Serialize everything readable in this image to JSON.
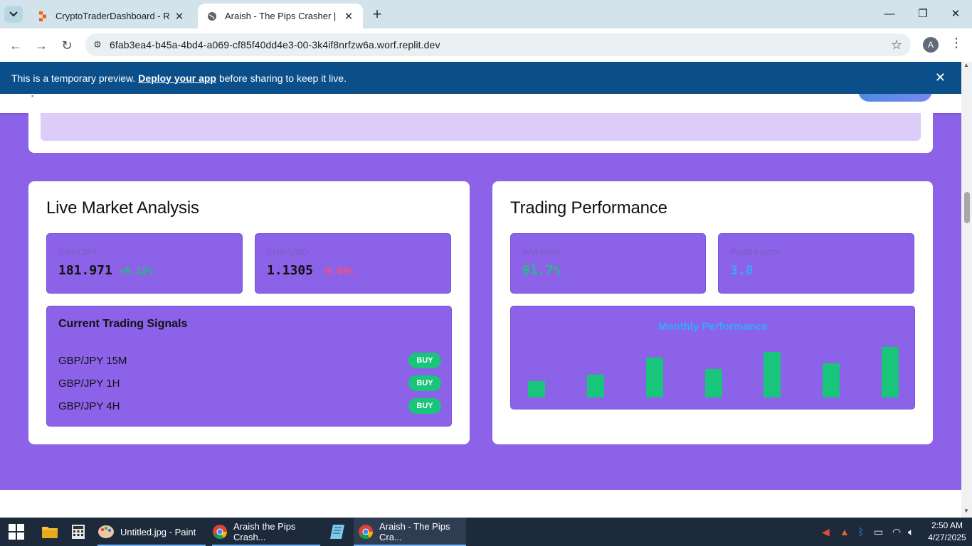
{
  "browser": {
    "tabs": [
      {
        "title": "CryptoTraderDashboard - Replit",
        "icon": "replit-icon"
      },
      {
        "title": "Araish - The Pips Crasher | Cryp",
        "icon": "globe-icon",
        "active": true
      }
    ],
    "url": "6fab3ea4-b45a-4bd4-a069-cf85f40dd4e3-00-3k4if8nrfzw6a.worf.replit.dev",
    "profile_initial": "A"
  },
  "banner": {
    "prefix": "This is a temporary preview.",
    "link": "Deploy your app",
    "suffix": "before sharing to keep it live."
  },
  "market": {
    "title": "Live Market Analysis",
    "pairs": [
      {
        "label": "GBP/JPY",
        "value": "181.971",
        "change": "+0.12%",
        "direction": "up"
      },
      {
        "label": "EUR/USD",
        "value": "1.1305",
        "change": "-0.08%",
        "direction": "down"
      }
    ],
    "signals_title": "Current Trading Signals",
    "signals": [
      {
        "pair": "GBP/JPY 15M",
        "action": "BUY"
      },
      {
        "pair": "GBP/JPY 1H",
        "action": "BUY"
      },
      {
        "pair": "GBP/JPY 4H",
        "action": "BUY"
      }
    ]
  },
  "performance": {
    "title": "Trading Performance",
    "stats": [
      {
        "label": "Win Rate",
        "value": "91.7%",
        "color": "#1ec27a"
      },
      {
        "label": "Profit Factor",
        "value": "3.8",
        "color": "#3aa6ff"
      }
    ],
    "chart_title": "Monthly Performance"
  },
  "chart_data": {
    "type": "bar",
    "title": "Monthly Performance",
    "categories": [
      "",
      "",
      "",
      "",
      "",
      "",
      ""
    ],
    "values": [
      23,
      32,
      56,
      40,
      64,
      48,
      71
    ],
    "ylim": [
      0,
      100
    ],
    "color": "#19c47b",
    "grid": false
  },
  "taskbar": {
    "items": [
      {
        "label": "Untitled.jpg - Paint",
        "icon": "paint-icon"
      },
      {
        "label": "Araish the Pips Crash...",
        "icon": "chrome-icon"
      },
      {
        "label": "Araish - The Pips Cra...",
        "icon": "chrome-icon",
        "active": true
      }
    ],
    "time": "2:50 AM",
    "date": "4/27/2025"
  }
}
